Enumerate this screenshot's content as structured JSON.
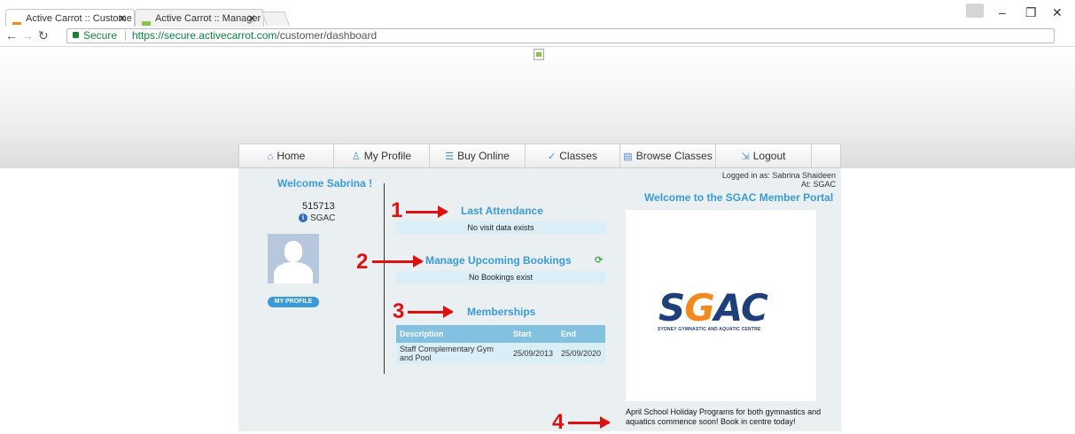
{
  "browser": {
    "tabs": [
      {
        "title": "Active Carrot :: Custome",
        "active": true
      },
      {
        "title": "Active Carrot :: Manager",
        "active": false
      }
    ],
    "secure_label": "Secure",
    "url_host": "https://secure.activecarrot.com",
    "url_path": "/customer/dashboard"
  },
  "menu": {
    "items": [
      {
        "label": "Home",
        "icon": "home-icon"
      },
      {
        "label": "My Profile",
        "icon": "user-icon"
      },
      {
        "label": "Buy Online",
        "icon": "cart-icon"
      },
      {
        "label": "Classes",
        "icon": "check-icon"
      },
      {
        "label": "Browse Classes",
        "icon": "calendar-icon"
      },
      {
        "label": "Logout",
        "icon": "logout-icon"
      }
    ]
  },
  "sidebar": {
    "welcome": "Welcome Sabrina !",
    "member_id": "515713",
    "club": "SGAC",
    "profile_button": "MY PROFILE"
  },
  "main": {
    "last_attendance": {
      "title": "Last Attendance",
      "message": "No visit data exists"
    },
    "bookings": {
      "title": "Manage Upcoming Bookings",
      "message": "No Bookings exist"
    },
    "memberships": {
      "title": "Memberships",
      "columns": [
        "Description",
        "Start",
        "End"
      ],
      "rows": [
        {
          "description": "Staff Complementary Gym and Pool",
          "start": "25/09/2013",
          "end": "25/09/2020"
        }
      ]
    }
  },
  "right_panel": {
    "logged_in": "Logged in as: Sabrina Shaideen",
    "at": "At: SGAC",
    "portal_title": "Welcome to the SGAC Member Portal",
    "logo_sub": "SYDNEY GYMNASTIC AND AQUATIC CENTRE",
    "news": "April School Holiday Programs for both gymnastics and aquatics commence soon! Book in centre today!"
  },
  "annotations": [
    "1",
    "2",
    "3",
    "4"
  ],
  "colors": {
    "accent": "#3a9ad9",
    "annotation": "#e01010",
    "panel": "#eaf0f2"
  }
}
